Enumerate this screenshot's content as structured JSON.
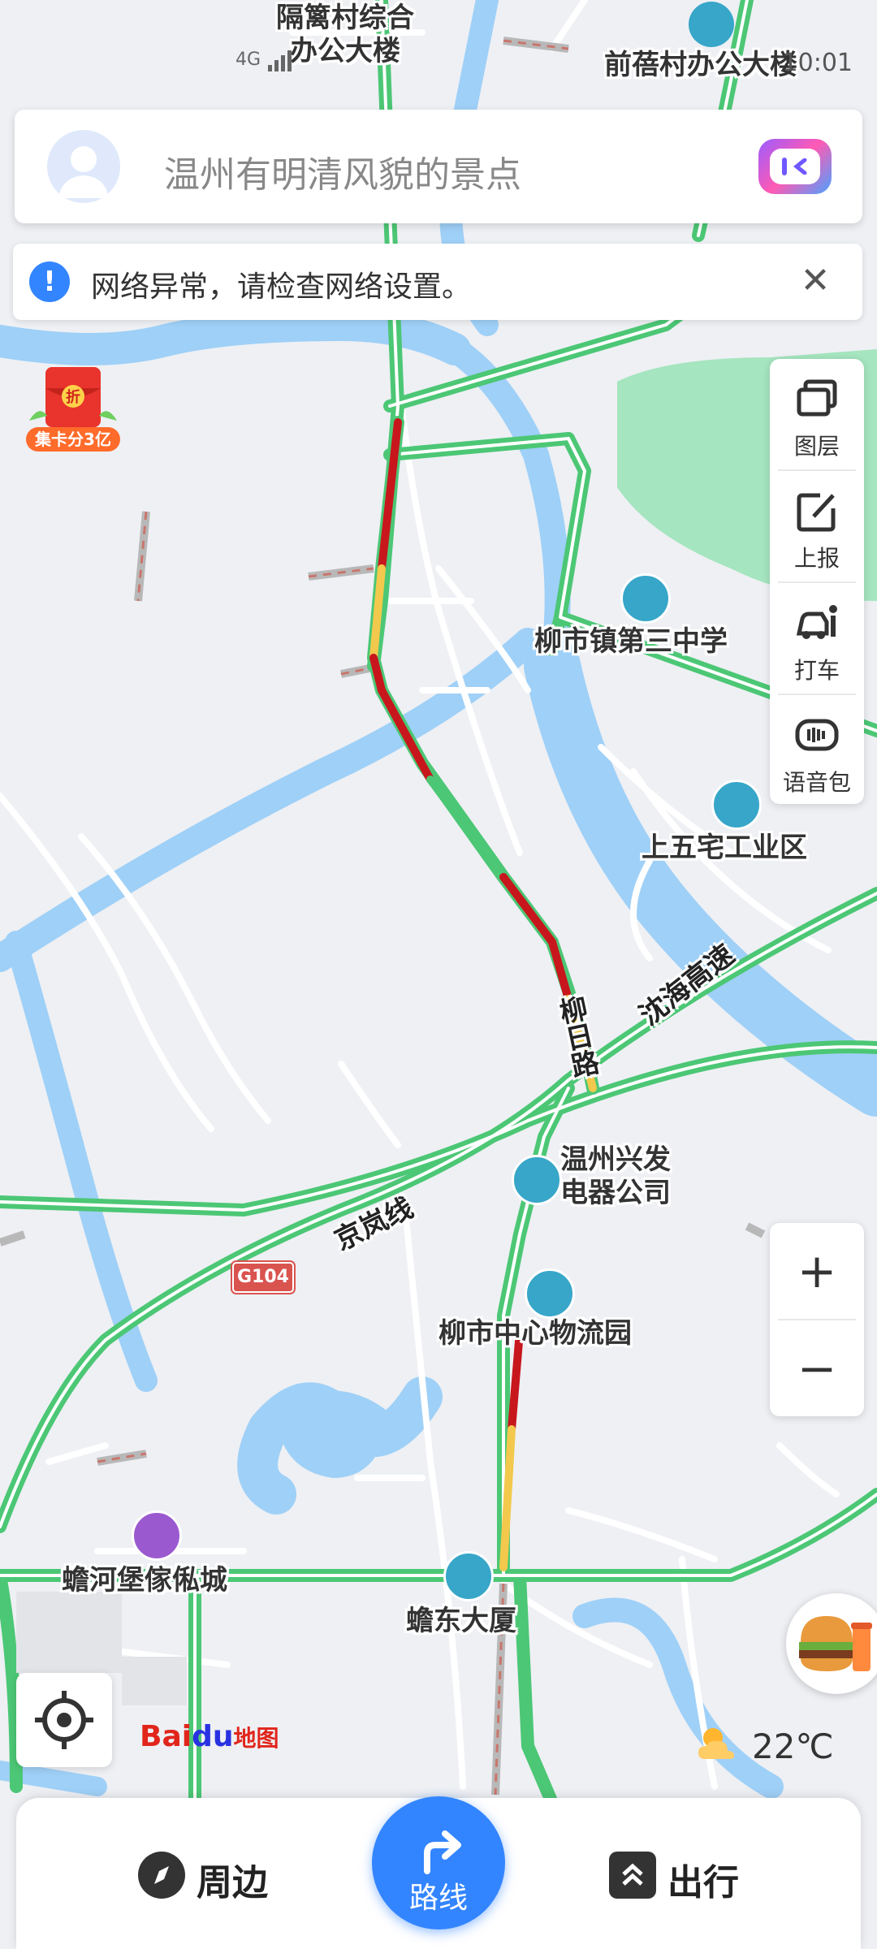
{
  "status_bar": {
    "network_label": "4G",
    "right_text": "10:01"
  },
  "search": {
    "placeholder": "温州有明清风貌的景点"
  },
  "network_banner": {
    "message": "网络异常，请检查网络设置。"
  },
  "side_tools": [
    {
      "label": "图层",
      "icon": "layers-icon"
    },
    {
      "label": "上报",
      "icon": "report-icon"
    },
    {
      "label": "打车",
      "icon": "taxi-icon"
    },
    {
      "label": "语音包",
      "icon": "voice-pack-icon"
    }
  ],
  "promo": {
    "text": "集卡分3亿",
    "badge": "折"
  },
  "zoom": {
    "in": "+",
    "out": "−"
  },
  "logo": {
    "bai": "Bai",
    "du": "du",
    "map": "地图"
  },
  "weather": {
    "temperature": "22℃"
  },
  "bottom_nav": {
    "nearby": "周边",
    "route": "路线",
    "trip": "出行"
  },
  "map": {
    "pois": [
      {
        "name": "隔篱村综合\n办公大楼"
      },
      {
        "name": "前蓓村办公大楼"
      },
      {
        "name": "柳市镇第三中学"
      },
      {
        "name": "上五宅工业区"
      },
      {
        "name": "温州兴发\n电器公司"
      },
      {
        "name": "柳市中心物流园"
      },
      {
        "name": "蟾河堡傢俬城"
      },
      {
        "name": "蟾东大厦"
      }
    ],
    "roads": {
      "liuri": "柳日路",
      "shenhai": "沈海高速",
      "jinglan": "京岚线",
      "g104": "G104"
    }
  },
  "colors": {
    "water": "#9fd0f7",
    "park": "#a5e5bf",
    "road_green": "#4cc775",
    "road_red": "#c8161d",
    "road_yellow": "#f2c94c",
    "accent": "#3385ff"
  }
}
